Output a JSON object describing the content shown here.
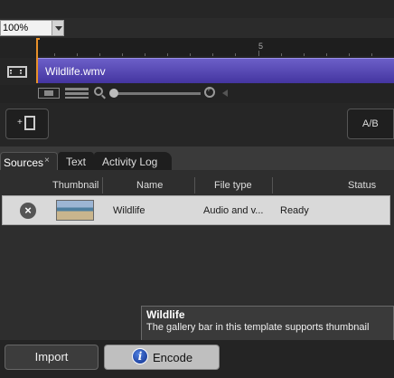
{
  "zoom": {
    "value": "100%"
  },
  "timeline": {
    "ruler_label": "5",
    "clip_name": "Wildlife.wmv"
  },
  "buttons": {
    "ab_label": "A/B",
    "add_clip_label": "+"
  },
  "tabs": [
    {
      "label": "Sources",
      "close": "×"
    },
    {
      "label": "Text"
    },
    {
      "label": "Activity Log"
    }
  ],
  "table": {
    "columns": [
      "Thumbnail",
      "Name",
      "File type",
      "Status"
    ],
    "rows": [
      {
        "remove": "×",
        "name": "Wildlife",
        "file_type": "Audio and v...",
        "status": "Ready"
      }
    ]
  },
  "tooltip": {
    "title": "Wildlife",
    "body": "The gallery bar in this template supports thumbnail"
  },
  "bottom": {
    "import_label": "Import",
    "encode_label": "Encode",
    "info_glyph": "i"
  },
  "colors": {
    "clip": "#5446b4",
    "playhead": "#e8912a",
    "row_bg": "#d9d9d9"
  }
}
